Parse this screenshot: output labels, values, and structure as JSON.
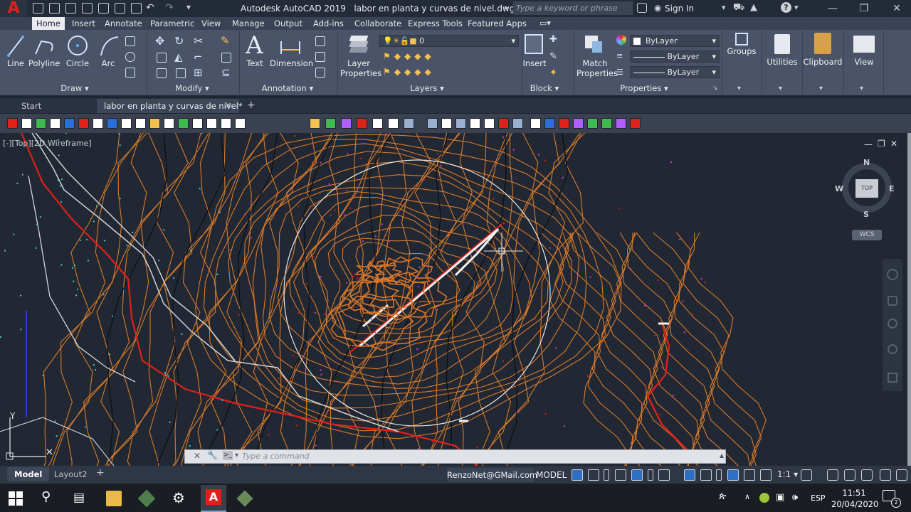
{
  "title_bar": {
    "app_name": "Autodesk AutoCAD 2019",
    "file_name": "labor en planta y curvas de nivel.dwg",
    "search_placeholder": "Type a keyword or phrase",
    "sign_in": "Sign In",
    "logo": "A"
  },
  "ribbon": {
    "tabs": [
      {
        "label": "Home",
        "active": true
      },
      {
        "label": "Insert"
      },
      {
        "label": "Annotate"
      },
      {
        "label": "Parametric"
      },
      {
        "label": "View"
      },
      {
        "label": "Manage"
      },
      {
        "label": "Output"
      },
      {
        "label": "Add-ins"
      },
      {
        "label": "Collaborate"
      },
      {
        "label": "Express Tools"
      },
      {
        "label": "Featured Apps"
      }
    ],
    "draw": {
      "title": "Draw",
      "line": "Line",
      "polyline": "Polyline",
      "circle": "Circle",
      "arc": "Arc"
    },
    "modify": {
      "title": "Modify"
    },
    "annotation": {
      "title": "Annotation",
      "text": "Text",
      "dimension": "Dimension"
    },
    "layers": {
      "title": "Layers",
      "layer_properties_1": "Layer",
      "layer_properties_2": "Properties",
      "current_layer": "0"
    },
    "block": {
      "title": "Block",
      "insert": "Insert"
    },
    "properties": {
      "title": "Properties",
      "match_1": "Match",
      "match_2": "Properties",
      "color": "ByLayer",
      "linetype": "ByLayer",
      "lineweight": "ByLayer"
    },
    "groups": {
      "label": "Groups"
    },
    "utilities": {
      "label": "Utilities"
    },
    "clipboard": {
      "label": "Clipboard"
    },
    "view": {
      "label": "View"
    }
  },
  "doc_tabs": {
    "start": "Start",
    "active": "labor en planta y curvas de nivel*"
  },
  "viewport": {
    "label": "[-][Top][2D Wireframe]"
  },
  "viewcube": {
    "north": "N",
    "south": "S",
    "east": "E",
    "west": "W",
    "top": "TOP",
    "wcs": "WCS"
  },
  "command_line": {
    "placeholder": "Type a command"
  },
  "layout_tabs": {
    "model": "Model",
    "layout2": "Layout2"
  },
  "status_bar": {
    "user": "RenzoNet@GMail.com",
    "space": "MODEL",
    "scale": "1:1"
  },
  "taskbar": {
    "language": "ESP",
    "time": "11:51",
    "date": "20/04/2020",
    "notification_count": "2"
  },
  "colors": {
    "contours": "#d97a2a",
    "road_red": "#e0201b",
    "canvas": "#212833"
  }
}
